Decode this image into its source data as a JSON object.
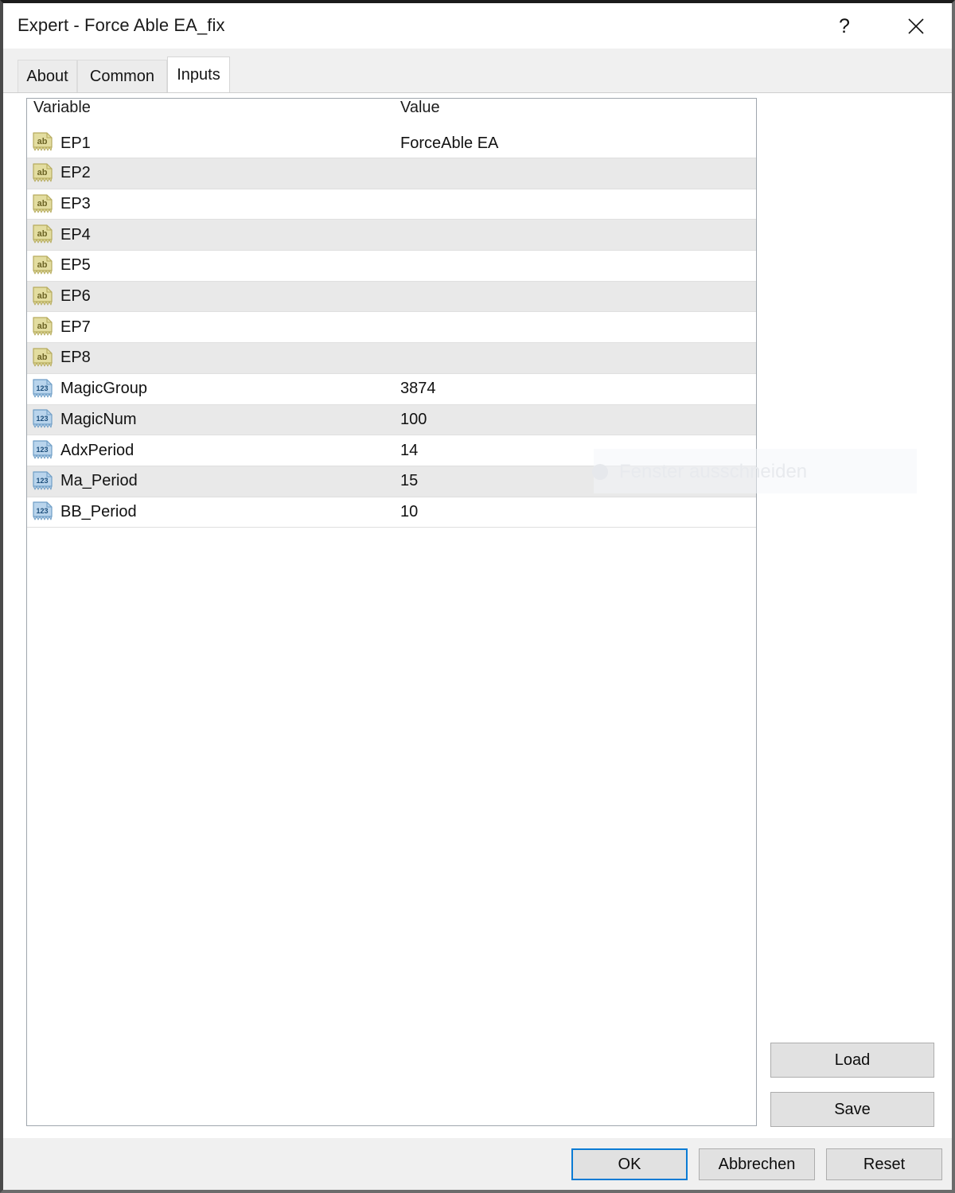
{
  "window": {
    "title": "Expert - Force Able EA_fix",
    "help_icon": "help-icon",
    "help_glyph": "?",
    "close_icon": "close-icon"
  },
  "tabs": [
    {
      "label": "About",
      "selected": false
    },
    {
      "label": "Common",
      "selected": false
    },
    {
      "label": "Inputs",
      "selected": true
    }
  ],
  "table": {
    "columns": {
      "variable": "Variable",
      "value": "Value"
    },
    "rows": [
      {
        "icon": "string-type-icon",
        "icon_text": "ab",
        "variable": "EP1",
        "value": "ForceAble EA"
      },
      {
        "icon": "string-type-icon",
        "icon_text": "ab",
        "variable": "EP2",
        "value": ""
      },
      {
        "icon": "string-type-icon",
        "icon_text": "ab",
        "variable": "EP3",
        "value": ""
      },
      {
        "icon": "string-type-icon",
        "icon_text": "ab",
        "variable": "EP4",
        "value": ""
      },
      {
        "icon": "string-type-icon",
        "icon_text": "ab",
        "variable": "EP5",
        "value": ""
      },
      {
        "icon": "string-type-icon",
        "icon_text": "ab",
        "variable": "EP6",
        "value": ""
      },
      {
        "icon": "string-type-icon",
        "icon_text": "ab",
        "variable": "EP7",
        "value": ""
      },
      {
        "icon": "string-type-icon",
        "icon_text": "ab",
        "variable": "EP8",
        "value": ""
      },
      {
        "icon": "numeric-type-icon",
        "icon_text": "123",
        "variable": "MagicGroup",
        "value": "3874"
      },
      {
        "icon": "numeric-type-icon",
        "icon_text": "123",
        "variable": "MagicNum",
        "value": "100"
      },
      {
        "icon": "numeric-type-icon",
        "icon_text": "123",
        "variable": "AdxPeriod",
        "value": "14"
      },
      {
        "icon": "numeric-type-icon",
        "icon_text": "123",
        "variable": "Ma_Period",
        "value": "15"
      },
      {
        "icon": "numeric-type-icon",
        "icon_text": "123",
        "variable": "BB_Period",
        "value": "10"
      }
    ]
  },
  "side_buttons": {
    "load": "Load",
    "save": "Save"
  },
  "footer_buttons": {
    "ok": "OK",
    "cancel": "Abbrechen",
    "reset": "Reset"
  },
  "overlay": {
    "watermark_text": "Fenster ausschneiden"
  },
  "colors": {
    "focus_border": "#0a7bd4",
    "row_alt": "#e9e9e9",
    "button_face": "#e1e1e1",
    "string_icon": "#d8cf8a",
    "numeric_icon": "#8fb8dd"
  }
}
